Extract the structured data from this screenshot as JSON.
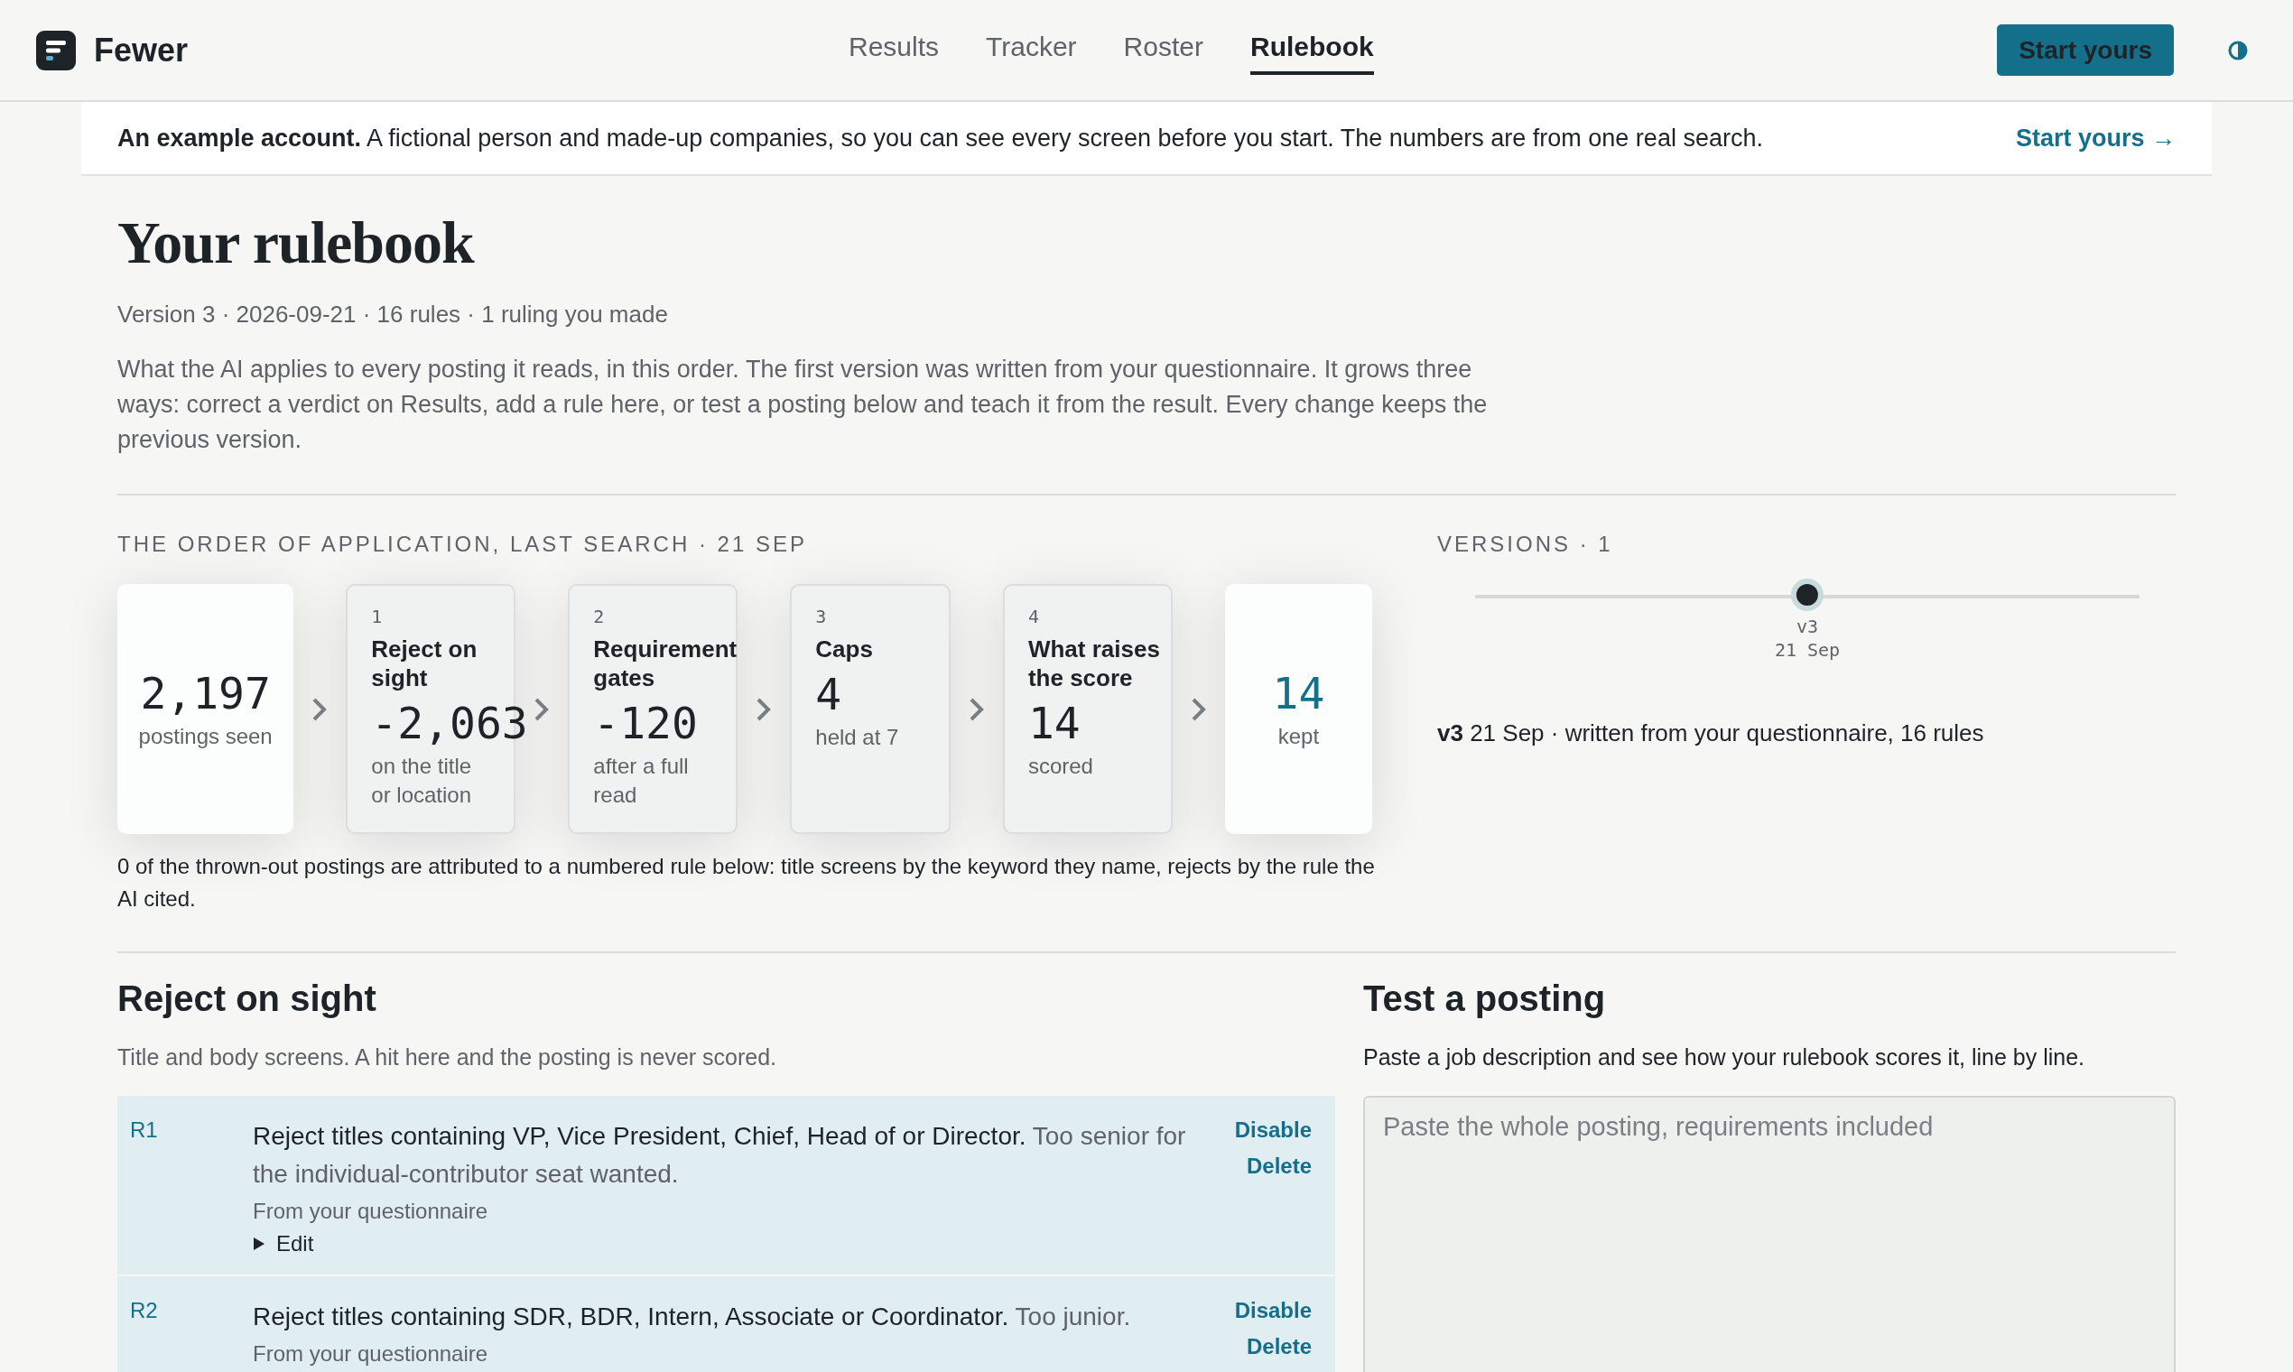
{
  "brand": {
    "name": "Fewer"
  },
  "nav": [
    {
      "label": "Results",
      "selected": false
    },
    {
      "label": "Tracker",
      "selected": false
    },
    {
      "label": "Roster",
      "selected": false
    },
    {
      "label": "Rulebook",
      "selected": true
    }
  ],
  "header_button": "Start yours",
  "banner": {
    "text": "**An example account.** A fictional person and made-up companies, so you can see every screen before you start. The numbers are from one real search.",
    "link": "Start yours →"
  },
  "page": {
    "title": "Your rulebook",
    "meta": "Version 3 · 2026-09-21 · 16 rules · 1 ruling you made",
    "intro": "What the AI applies to every posting it reads, in this order. The first version was written from your questionnaire. It grows three ways: correct a verdict on Results, add a rule here, or test a posting below and teach it from the result. Every change keeps the previous version."
  },
  "pipeline": {
    "heading": "THE ORDER OF APPLICATION, LAST SEARCH · 21 SEP",
    "stages": [
      {
        "kind": "total",
        "value": "2,197",
        "note": "postings seen"
      },
      {
        "kind": "stage",
        "step": "1",
        "title": "Reject on sight",
        "value": "-2,063",
        "note": "on the title or location"
      },
      {
        "kind": "stage",
        "step": "2",
        "title": "Requirement gates",
        "value": "-120",
        "note": "after a full read"
      },
      {
        "kind": "stage",
        "step": "3",
        "title": "Caps",
        "value": "4",
        "note": "held at 7"
      },
      {
        "kind": "stage",
        "step": "4",
        "title": "What raises the score",
        "value": "14",
        "note": "scored"
      },
      {
        "kind": "kept",
        "value": "14",
        "note": "kept"
      }
    ],
    "caption": "0 of the thrown-out postings are attributed to a numbered rule below: title screens by the keyword they name, rejects by the rule the AI cited."
  },
  "versions": {
    "heading": "VERSIONS · 1",
    "items": [
      {
        "label": "v3",
        "date": "21 Sep",
        "selected": true
      }
    ],
    "summary": "**v3** 21 Sep · written from your questionnaire, 16 rules"
  },
  "reject_section": {
    "title": "Reject on sight",
    "subtitle": "Title and body screens. A hit here and the posting is never scored.",
    "rules": [
      {
        "id": "R1",
        "rule": "Reject titles containing VP, Vice President, Chief, Head of or Director.",
        "reason": "Too senior for the individual-contributor seat wanted.",
        "source": "From your questionnaire",
        "edit": {
          "label": "Edit",
          "expanded": false
        },
        "actions": [
          "Disable",
          "Delete"
        ]
      },
      {
        "id": "R2",
        "rule": "Reject titles containing SDR, BDR, Intern, Associate or Coordinator.",
        "reason": "Too junior.",
        "source": "From your questionnaire",
        "actions": [
          "Disable",
          "Delete"
        ]
      }
    ]
  },
  "test_section": {
    "title": "Test a posting",
    "subtitle": "Paste a job description and see how your rulebook scores it, line by line.",
    "placeholder": "Paste the whole posting, requirements included"
  }
}
